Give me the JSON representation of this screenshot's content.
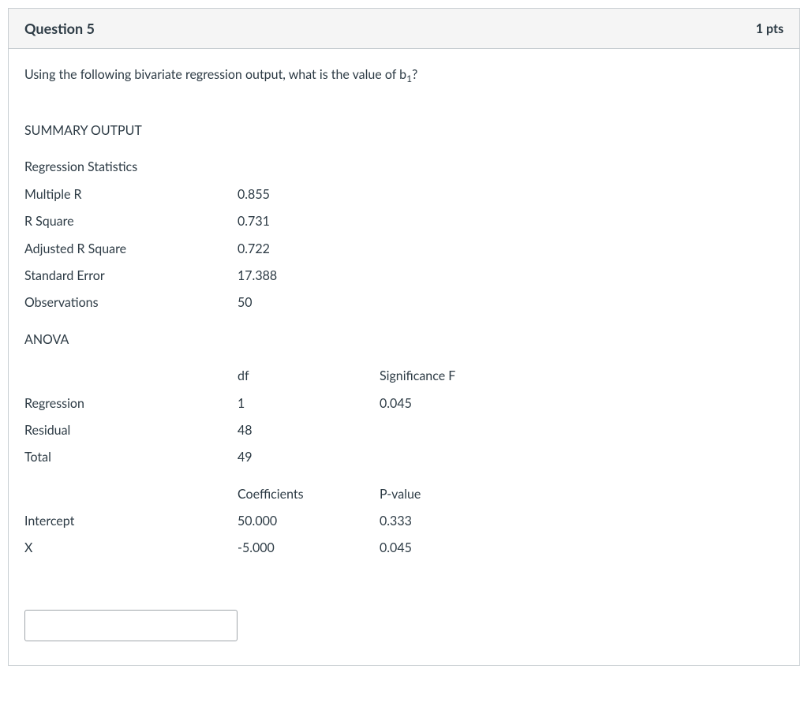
{
  "header": {
    "title": "Question 5",
    "points": "1 pts"
  },
  "prompt": {
    "text_before_sub": "Using the following bivariate regression output, what is the value of b",
    "subscript": "1",
    "text_after_sub": "?"
  },
  "summary_output_label": "SUMMARY OUTPUT",
  "stats_header": "Regression Statistics",
  "stats": [
    {
      "label": "Multiple R",
      "value": "0.855"
    },
    {
      "label": "R Square",
      "value": "0.731"
    },
    {
      "label": "Adjusted R Square",
      "value": "0.722"
    },
    {
      "label": "Standard Error",
      "value": "17.388"
    },
    {
      "label": "Observations",
      "value": "50"
    }
  ],
  "anova_header": "ANOVA",
  "anova_col1": "df",
  "anova_col2": "Significance F",
  "anova": [
    {
      "label": "Regression",
      "df": "1",
      "sigf": "0.045"
    },
    {
      "label": "Residual",
      "df": "48",
      "sigf": ""
    },
    {
      "label": "Total",
      "df": "49",
      "sigf": ""
    }
  ],
  "coef_col1": "Coefficients",
  "coef_col2": "P-value",
  "coef": [
    {
      "label": "Intercept",
      "coef": "50.000",
      "pval": "0.333"
    },
    {
      "label": "X",
      "coef": "-5.000",
      "pval": "0.045"
    }
  ],
  "answer": {
    "placeholder": "",
    "value": ""
  }
}
